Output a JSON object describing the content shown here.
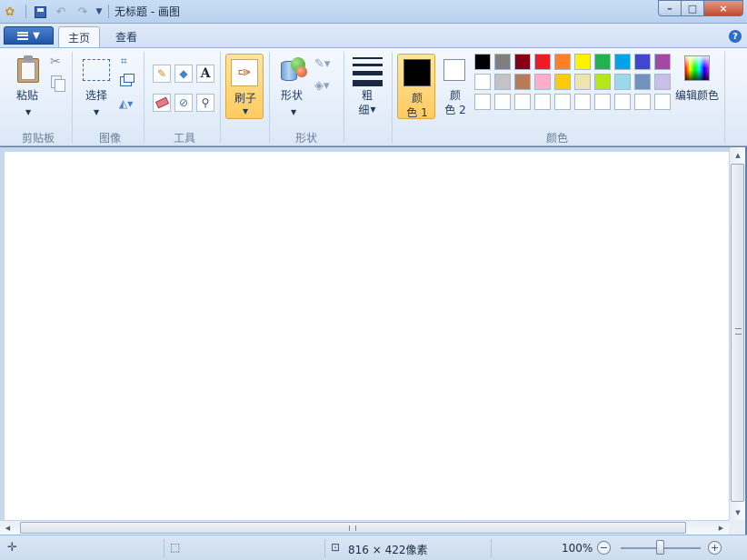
{
  "window": {
    "title": "无标题 - 画图",
    "app_icon": "paint-palette-icon",
    "quick_access": [
      "save-icon",
      "undo-icon",
      "redo-icon",
      "customize-qat-icon"
    ],
    "controls": {
      "minimize": "–",
      "maximize": "□",
      "close": "×"
    }
  },
  "ribbon": {
    "app_menu": "paint-menu-button",
    "tabs": [
      {
        "label": "主页",
        "active": true
      },
      {
        "label": "查看",
        "active": false
      }
    ],
    "help": "?",
    "groups": {
      "clipboard": {
        "label": "剪贴板",
        "paste": "粘贴",
        "icons": [
          "cut-icon",
          "copy-icon"
        ]
      },
      "image": {
        "label": "图像",
        "select": "选择",
        "icons": [
          "crop-icon",
          "resize-icon",
          "rotate-icon"
        ]
      },
      "tools": {
        "label": "工具",
        "icons": [
          "pencil-icon",
          "fill-bucket-icon",
          "text-icon",
          "eraser-icon",
          "color-picker-icon",
          "magnifier-icon"
        ],
        "text_glyph": "A"
      },
      "brushes": {
        "label": "刷子"
      },
      "shapes": {
        "label": "形状",
        "button": "形状",
        "icons": [
          "outline-icon",
          "fill-icon"
        ]
      },
      "size": {
        "label_line1": "粗",
        "label_line2": "细"
      },
      "colors": {
        "label": "颜色",
        "color1_line1": "颜",
        "color1_line2": "色 1",
        "color2_line1": "颜",
        "color2_line2": "色 2",
        "color1": "#000000",
        "color2": "#ffffff",
        "palette": [
          "#000000",
          "#7f7f7f",
          "#880015",
          "#ed1c24",
          "#ff7f27",
          "#fff200",
          "#22b14c",
          "#00a2e8",
          "#3f48cc",
          "#a349a4",
          "#ffffff",
          "#c3c3c3",
          "#b97a57",
          "#ffaec9",
          "#ffc90e",
          "#efe4b0",
          "#b5e61d",
          "#99d9ea",
          "#7092be",
          "#c8bfe7",
          "#ffffff",
          "#ffffff",
          "#ffffff",
          "#ffffff",
          "#ffffff",
          "#ffffff",
          "#ffffff",
          "#ffffff",
          "#ffffff",
          "#ffffff"
        ],
        "edit_colors": "编辑颜色"
      }
    }
  },
  "canvas": {
    "background": "#ffffff"
  },
  "statusbar": {
    "cursor_icon": "cursor-position-icon",
    "selection_icon": "selection-size-icon",
    "canvas_size_text": "816 × 422像素",
    "zoom": "100%",
    "zoom_fraction": 0.5
  }
}
